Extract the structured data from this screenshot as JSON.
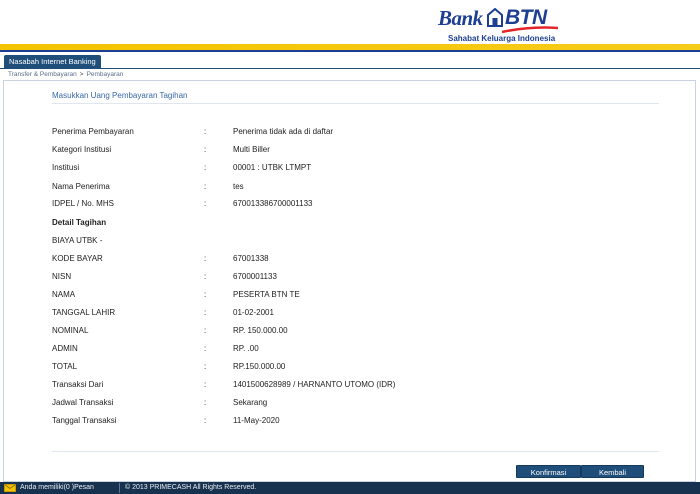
{
  "header": {
    "logo_bank": "Bank",
    "logo_btn": "BTN",
    "tagline": "Sahabat Keluarga Indonesia",
    "brand_blue": "#1d3f93",
    "brand_yellow": "#f4c400",
    "brand_red": "#e3262a"
  },
  "tab": {
    "label": "Nasabah Internet Banking"
  },
  "breadcrumb": {
    "items": [
      "Transfer & Pembayaran",
      "Pembayaran"
    ],
    "separator": ">"
  },
  "section": {
    "title": "Masukkan Uang Pembayaran Tagihan"
  },
  "details": [
    {
      "label": "Penerima Pembayaran",
      "colon": ":",
      "value": "Penerima tidak ada di daftar"
    },
    {
      "label": "Kategori Institusi",
      "colon": ":",
      "value": "Multi Biller"
    },
    {
      "label": "Institusi",
      "colon": ":",
      "value": "00001 : UTBK LTMPT"
    },
    {
      "label": "Nama Penerima",
      "colon": ":",
      "value": "tes"
    },
    {
      "label": "IDPEL / No. MHS",
      "colon": ":",
      "value": "670013386700001133"
    },
    {
      "label": "Detail Tagihan",
      "colon": "",
      "value": "",
      "bold": true
    },
    {
      "label": "BIAYA UTBK -",
      "colon": "",
      "value": ""
    },
    {
      "label": "KODE BAYAR",
      "colon": ":",
      "value": "67001338"
    },
    {
      "label": "NISN",
      "colon": ":",
      "value": "6700001133"
    },
    {
      "label": "NAMA",
      "colon": ":",
      "value": "PESERTA BTN TE"
    },
    {
      "label": "TANGGAL LAHIR",
      "colon": ":",
      "value": "01-02-2001"
    },
    {
      "label": "NOMINAL",
      "colon": ":",
      "value": "RP. 150.000.00"
    },
    {
      "label": "ADMIN",
      "colon": ":",
      "value": "RP. .00"
    },
    {
      "label": "TOTAL",
      "colon": ":",
      "value": "RP.150.000.00"
    },
    {
      "label": "Transaksi Dari",
      "colon": ":",
      "value": "1401500628989 / HARNANTO UTOMO (IDR)"
    },
    {
      "label": "Jadwal Transaksi",
      "colon": ":",
      "value": "Sekarang"
    },
    {
      "label": "Tanggal Transaksi",
      "colon": ":",
      "value": "11-May-2020"
    }
  ],
  "buttons": {
    "confirm": "Konfirmasi",
    "back": "Kembali"
  },
  "status": {
    "messages": "Anda memiliki(0 )Pesan",
    "copyright": "© 2013 PRIMECASH All Rights Reserved."
  },
  "icons": {
    "mail": "mail-icon",
    "logo": "house-logo-icon"
  }
}
